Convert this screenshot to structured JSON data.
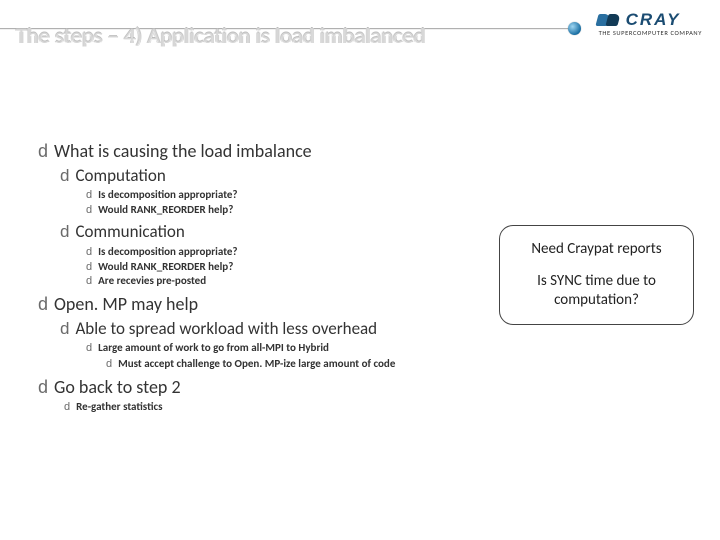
{
  "logo": {
    "text": "CRAY",
    "tagline": "THE SUPERCOMPUTER COMPANY"
  },
  "title": "The steps – 4) Application is load imbalanced",
  "bullet_glyph": "d",
  "body": {
    "items": [
      {
        "text": "What is causing the load imbalance",
        "children": [
          {
            "text": "Computation",
            "children": [
              {
                "text": "Is decomposition appropriate?"
              },
              {
                "text": "Would RANK_REORDER help?"
              }
            ]
          },
          {
            "text": "Communication",
            "children": [
              {
                "text": "Is decomposition appropriate?"
              },
              {
                "text": "Would RANK_REORDER help?"
              },
              {
                "text": "Are recevies pre-posted"
              }
            ]
          }
        ]
      },
      {
        "text": "Open. MP may help",
        "children": [
          {
            "text": "Able to spread workload with less overhead",
            "children": [
              {
                "text": "Large amount of work to go from all-MPI to Hybrid",
                "children": [
                  {
                    "text": "Must accept challenge to Open. MP-ize large amount of code"
                  }
                ]
              }
            ]
          }
        ]
      },
      {
        "text": "Go back to step 2",
        "children": [
          {
            "text_small": "Re-gather statistics"
          }
        ]
      }
    ]
  },
  "callout": {
    "line1": "Need Craypat reports",
    "line2": "Is SYNC time due to computation?"
  }
}
